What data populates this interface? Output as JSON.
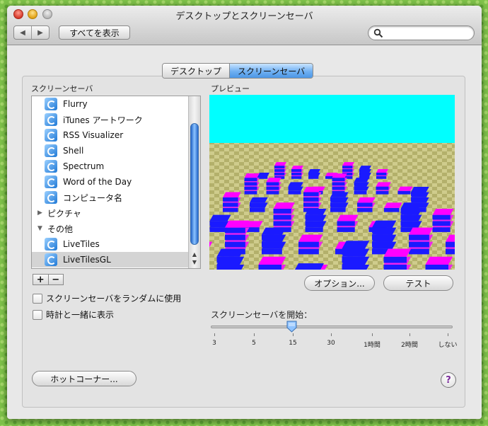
{
  "window": {
    "title": "デスクトップとスクリーンセーバ"
  },
  "toolbar": {
    "show_all_label": "すべてを表示",
    "search_placeholder": ""
  },
  "tabs": [
    {
      "label": "デスクトップ",
      "selected": false
    },
    {
      "label": "スクリーンセーバ",
      "selected": true
    }
  ],
  "list": {
    "heading": "スクリーンセーバ",
    "items": [
      {
        "label": "Flurry",
        "kind": "item"
      },
      {
        "label": "iTunes アートワーク",
        "kind": "item"
      },
      {
        "label": "RSS Visualizer",
        "kind": "item"
      },
      {
        "label": "Shell",
        "kind": "item"
      },
      {
        "label": "Spectrum",
        "kind": "item"
      },
      {
        "label": "Word of the Day",
        "kind": "item"
      },
      {
        "label": "コンピュータ名",
        "kind": "item"
      },
      {
        "label": "ピクチャ",
        "kind": "group-collapsed"
      },
      {
        "label": "その他",
        "kind": "group-expanded"
      },
      {
        "label": "LiveTiles",
        "kind": "item"
      },
      {
        "label": "LiveTilesGL",
        "kind": "item",
        "selected": true
      }
    ],
    "add_label": "+",
    "remove_label": "−"
  },
  "options": {
    "random_label": "スクリーンセーバをランダムに使用",
    "random_checked": false,
    "clock_label": "時計と一緒に表示",
    "clock_checked": false
  },
  "preview": {
    "heading": "プレビュー",
    "options_button": "オプション...",
    "test_button": "テスト"
  },
  "start": {
    "heading": "スクリーンセーバを開始：",
    "ticks": [
      "3",
      "5",
      "15",
      "30",
      "1時間",
      "2時間",
      "しない"
    ],
    "selected": "15"
  },
  "hot_corners_button": "ホットコーナー...",
  "help_label": "?",
  "colors": {
    "sky": "#00ffff",
    "tile_top": "#ff00ff",
    "tile_side": "#1a1aff",
    "selection": "#d4d4d4"
  }
}
